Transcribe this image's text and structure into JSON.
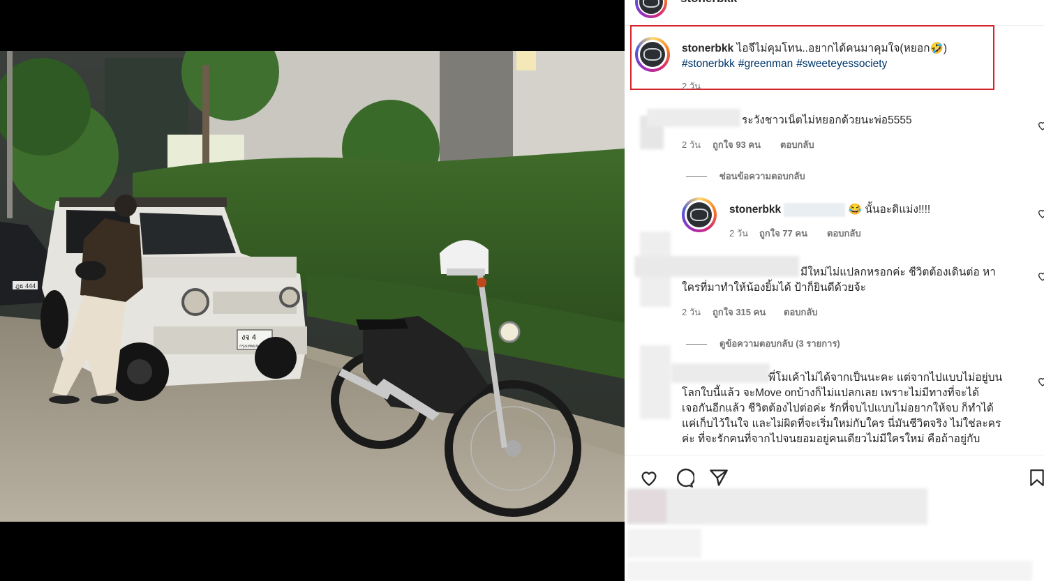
{
  "post": {
    "top_username": "stonerbkk",
    "caption_username": "stonerbkk",
    "caption_text": "ไอจีไม่คุมโทน..อยากได้คนมาคุมใจ(หยอก🤣)",
    "hashtags": [
      "#stonerbkk",
      "#greenman",
      "#sweeteyessociety"
    ],
    "caption_time": "2 วัน"
  },
  "comments": [
    {
      "text": "ระวังชาวเน็ตไม่หยอกด้วยนะพ่อ5555",
      "time": "2 วัน",
      "likes": "ถูกใจ 93 คน",
      "reply": "ตอบกลับ",
      "thread_toggle": "ซ่อนข้อความตอบกลับ"
    },
    {
      "username": "stonerbkk",
      "text": "😂 นั้นอะดิแม่ง!!!!",
      "time": "2 วัน",
      "likes": "ถูกใจ 77 คน",
      "reply": "ตอบกลับ"
    },
    {
      "line1": "มีใหม่ไม่แปลกหรอกค่ะ ชีวิตต้องเดินต่อ หา",
      "line2": "ใครที่มาทำให้น้องยิ้มได้ ป้าก็ยินดีด้วยจ้ะ",
      "time": "2 วัน",
      "likes": "ถูกใจ 315 คน",
      "reply": "ตอบกลับ",
      "thread_toggle": "ดูข้อความตอบกลับ (3 รายการ)"
    },
    {
      "lines": [
        "พี่โมเค้าไม่ได้จากเป็นนะคะ แต่จากไปแบบไม่อยู่บน",
        "โลกใบนี้แล้ว จะMove onบ้างก็ไม่แปลกเลย เพราะไม่มีทางที่จะได้",
        "เจอกันอีกแล้ว ชีวิตต้องไปต่อค่ะ รักที่จบไปแบบไม่อยากให้จบ ก็ทำได้",
        "แค่เก็บไว้ในใจ และไม่ผิดที่จะเริ่มใหม่กับใคร นี่มันชีวิตจริง ไม่ใช่ละคร",
        "ค่ะ ที่จะรักคนที่จากไปจนยอมอยู่คนเดียวไม่มีใครใหม่ คือถ้าอยู่กับ"
      ]
    }
  ],
  "photo": {
    "plate": "งจ 4",
    "plate_province": "กรุงเทพมหานคร",
    "plate_left_car": "ฎธ 444"
  },
  "icons": [
    "heart-icon",
    "comment-icon",
    "share-icon",
    "bookmark-icon"
  ],
  "colors": {
    "highlight": "#d8232a",
    "hashtag": "#00376b",
    "meta": "#737373"
  }
}
